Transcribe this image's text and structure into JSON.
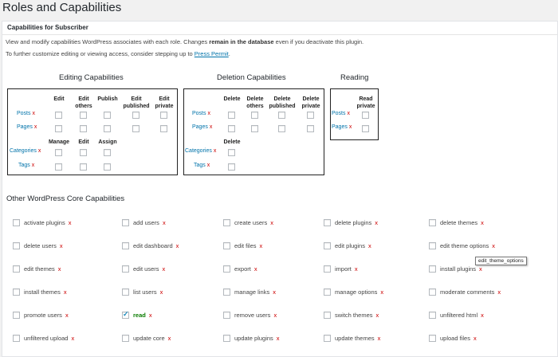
{
  "page": {
    "title": "Roles and Capabilities"
  },
  "panel": {
    "header": "Capabilities for Subscriber",
    "intro_line1_a": "View and modify capabilities WordPress associates with each role. Changes ",
    "intro_line1_b": "remain in the database",
    "intro_line1_c": " even if you deactivate this plugin.",
    "intro_line2_a": "To further customize editing or viewing access, consider stepping up to ",
    "intro_link": "Press Permit",
    "intro_line2_c": "."
  },
  "editing": {
    "title": "Editing Capabilities",
    "columns": [
      "Edit",
      "Edit others",
      "Publish",
      "Edit published",
      "Edit private"
    ],
    "rows": [
      {
        "label": "Posts",
        "x": "x"
      },
      {
        "label": "Pages",
        "x": "x"
      }
    ],
    "columns2": [
      "Manage",
      "Edit",
      "Assign"
    ],
    "rows2": [
      {
        "label": "Categories",
        "x": "x"
      },
      {
        "label": "Tags",
        "x": "x"
      }
    ]
  },
  "deletion": {
    "title": "Deletion Capabilities",
    "columns": [
      "Delete",
      "Delete others",
      "Delete published",
      "Delete private"
    ],
    "rows": [
      {
        "label": "Posts",
        "x": "x"
      },
      {
        "label": "Pages",
        "x": "x"
      }
    ],
    "columns2": [
      "Delete"
    ],
    "rows2": [
      {
        "label": "Categories",
        "x": "x"
      },
      {
        "label": "Tags",
        "x": "x"
      }
    ]
  },
  "reading": {
    "title": "Reading",
    "columns": [
      "Read private"
    ],
    "rows": [
      {
        "label": "Posts",
        "x": "x"
      },
      {
        "label": "Pages",
        "x": "x"
      }
    ]
  },
  "core": {
    "title": "Other WordPress Core Capabilities",
    "x": "x",
    "items": [
      "activate plugins",
      "add users",
      "create users",
      "delete plugins",
      "delete themes",
      "delete users",
      "edit dashboard",
      "edit files",
      "edit plugins",
      "edit theme options",
      "edit themes",
      "edit users",
      "export",
      "import",
      "install plugins",
      "install themes",
      "list users",
      "manage links",
      "manage options",
      "moderate comments",
      "promote users",
      "read",
      "remove users",
      "switch themes",
      "unfiltered html",
      "unfiltered upload",
      "update core",
      "update plugins",
      "update themes",
      "upload files"
    ],
    "checked": [
      "read"
    ]
  },
  "tooltip": "edit_theme_options"
}
